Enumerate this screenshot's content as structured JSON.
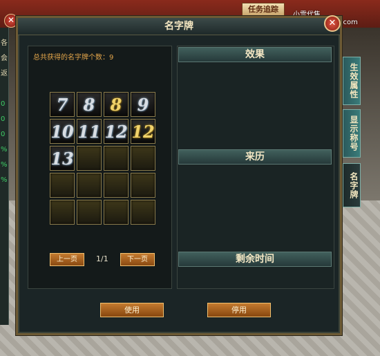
{
  "window": {
    "title": "名字牌"
  },
  "scene": {
    "quest_button": "任务追踪",
    "watermark": "小雪代售www.xxds777.com",
    "left_panel_chars": [
      "各",
      "会",
      "返"
    ],
    "left_panel_values": [
      "0",
      "0",
      "0",
      "%",
      "%",
      "%"
    ]
  },
  "collection": {
    "count_label": "总共获得的名字牌个数：9",
    "items": [
      {
        "glyph": "7",
        "gold": false
      },
      {
        "glyph": "8",
        "gold": false
      },
      {
        "glyph": "8",
        "gold": true
      },
      {
        "glyph": "9",
        "gold": false
      },
      {
        "glyph": "10",
        "gold": false
      },
      {
        "glyph": "11",
        "gold": false
      },
      {
        "glyph": "12",
        "gold": false
      },
      {
        "glyph": "12",
        "gold": true
      },
      {
        "glyph": "13",
        "gold": false
      },
      {
        "glyph": "",
        "gold": false
      },
      {
        "glyph": "",
        "gold": false
      },
      {
        "glyph": "",
        "gold": false
      },
      {
        "glyph": "",
        "gold": false
      },
      {
        "glyph": "",
        "gold": false
      },
      {
        "glyph": "",
        "gold": false
      },
      {
        "glyph": "",
        "gold": false
      },
      {
        "glyph": "",
        "gold": false
      },
      {
        "glyph": "",
        "gold": false
      },
      {
        "glyph": "",
        "gold": false
      },
      {
        "glyph": "",
        "gold": false
      }
    ],
    "prev_page": "上一页",
    "page_indicator": "1/1",
    "next_page": "下一页"
  },
  "details": {
    "effect_header": "效果",
    "source_header": "来历",
    "time_header": "剩余时间"
  },
  "actions": {
    "use": "使用",
    "disable": "停用"
  },
  "side_tabs": [
    "生效属性",
    "显示称号",
    "名字牌"
  ]
}
